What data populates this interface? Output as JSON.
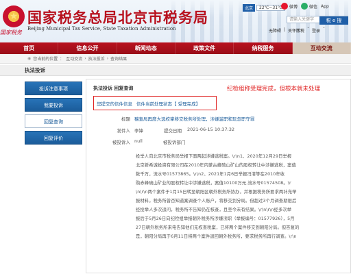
{
  "header": {
    "title_cn": "国家税务总局北京市税务局",
    "title_en": "Beijing Municipal Tax Service, State Taxation Administration",
    "logo_text": "国家税务",
    "weather_city": "北京",
    "weather_temp": "22℃~31℃",
    "weibo": "微博",
    "wechat": "微信",
    "app": "App",
    "search_placeholder": "请输入关键字",
    "tax_button": "税 e 搜",
    "links": [
      "无障碍",
      "|",
      "关怀版"
    ],
    "login": [
      "个税",
      "ˇ",
      "登录",
      "ˇ"
    ]
  },
  "nav": [
    "首页",
    "信息公开",
    "新闻动态",
    "政策文件",
    "纳税服务",
    "互动交流"
  ],
  "breadcrumb": [
    "您当前的位置",
    "互动交流",
    "执法投诉",
    "查询结果"
  ],
  "section_title": "执法投诉",
  "sidebar": [
    "投诉注意事项",
    "我要投诉",
    "回复查询",
    "回复评价"
  ],
  "content": {
    "heading": "执法投诉  回复查询",
    "annotation": "纪检组称受理完成，但根本就未处理",
    "status_label": "您提交的信件信息",
    "status_text": "信件当前处理状态【 受理完成】",
    "fields": [
      {
        "label": "标题",
        "value": "稽查局再度大选校掌移交税务所处理，涉嫌滥职和玩忽职守罪"
      },
      {
        "label": "发件人",
        "value": "李锋",
        "sub_label": "提交日期",
        "sub_value": "2021-06-15 10:37:32"
      },
      {
        "label": "被投诉人",
        "value": "null",
        "sub_label": "被投诉部门",
        "sub_value": ""
      }
    ],
    "body_lines": [
      "投举人向北京市税务局举报下面两起涉嫌逃税案。\\r\\n1、2020年12月29日举报",
      "北京新希诚投资有限公司在2010年内蒙古峰硫山矿山的股权转让中涉嫌逃税，案值",
      "数千万，流水号01573865。\\r\\n2、2021年1月6日举报冯清等在2010年收",
      "购赤峰硫山矿业的股权转让中涉嫌逃税，案值10100万元,流水号01574508。\\r",
      "\\n\\r\\n两个案件于1月15日转至朝阳区朝外税务所协办，并根据税务所要求两补充举",
      "报材料。税务所曾否知道案调查个人账户，将移交到分局。但超过3个月调查期限后",
      "经投举人多次追问，税务所不告知仍在核查，且至今未有结果。\\r\\n\\r\\n经多次举",
      "报后于5月26日向纪检组举报朝外税务所涉嫌渎职（举报编号：01577926），5月",
      "27日朝外税务所来电告知他们无权查税案，已将两个案件移交到朝阳分局。但答复的",
      "是，朝阳分局再于6月11日将两个案件退回朝外税务所，要求税务所再行调查。\\r\\n"
    ]
  }
}
